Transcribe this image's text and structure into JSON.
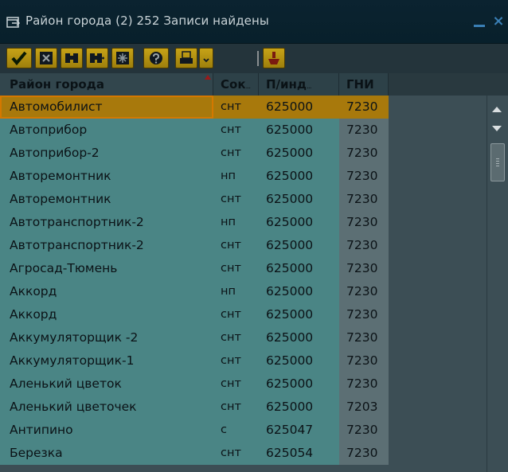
{
  "window": {
    "title": "Район города (2)  252 Записи найдены",
    "close_glyph": "×"
  },
  "toolbar": {
    "buttons": [
      {
        "icon": "checkmark-icon",
        "tooltip": ""
      },
      {
        "icon": "cancel-icon",
        "tooltip": ""
      },
      {
        "icon": "find-icon",
        "tooltip": ""
      },
      {
        "icon": "find-next-icon",
        "tooltip": ""
      },
      {
        "icon": "settings-icon",
        "tooltip": ""
      },
      {
        "icon": "help-icon",
        "tooltip": ""
      },
      {
        "icon": "print-icon",
        "tooltip": ""
      },
      {
        "icon": "dropdown-icon",
        "tooltip": ""
      },
      {
        "icon": "filter-icon",
        "tooltip": ""
      }
    ]
  },
  "table": {
    "columns": {
      "city": "Район города",
      "sok": "Сок",
      "post": "П/инд",
      "gni": "ГНИ",
      "ellipsis": "..."
    },
    "rows": [
      {
        "city": "Автомобилист",
        "sok": "снт",
        "post": "625000",
        "gni": "7230"
      },
      {
        "city": "Автоприбор",
        "sok": "снт",
        "post": "625000",
        "gni": "7230"
      },
      {
        "city": "Автоприбор-2",
        "sok": "снт",
        "post": "625000",
        "gni": "7230"
      },
      {
        "city": "Авторемонтник",
        "sok": "нп",
        "post": "625000",
        "gni": "7230"
      },
      {
        "city": "Авторемонтник",
        "sok": "снт",
        "post": "625000",
        "gni": "7230"
      },
      {
        "city": "Автотранспортник-2",
        "sok": "нп",
        "post": "625000",
        "gni": "7230"
      },
      {
        "city": "Автотранспортник-2",
        "sok": "снт",
        "post": "625000",
        "gni": "7230"
      },
      {
        "city": "Агросад-Тюмень",
        "sok": "снт",
        "post": "625000",
        "gni": "7230"
      },
      {
        "city": "Аккорд",
        "sok": "нп",
        "post": "625000",
        "gni": "7230"
      },
      {
        "city": "Аккорд",
        "sok": "снт",
        "post": "625000",
        "gni": "7230"
      },
      {
        "city": "Аккумуляторщик -2",
        "sok": "снт",
        "post": "625000",
        "gni": "7230"
      },
      {
        "city": "Аккумуляторщик-1",
        "sok": "снт",
        "post": "625000",
        "gni": "7230"
      },
      {
        "city": "Аленький цветок",
        "sok": "снт",
        "post": "625000",
        "gni": "7230"
      },
      {
        "city": "Аленький цветочек",
        "sok": "снт",
        "post": "625000",
        "gni": "7203"
      },
      {
        "city": "Антипино",
        "sok": "с",
        "post": "625047",
        "gni": "7230"
      },
      {
        "city": "Березка",
        "sok": "снт",
        "post": "625054",
        "gni": "7230"
      }
    ],
    "selected_index": 0
  },
  "colors": {
    "selection": "#a8790c",
    "row_bg": "#4a8585",
    "toolbar_button": "#c7a317"
  }
}
